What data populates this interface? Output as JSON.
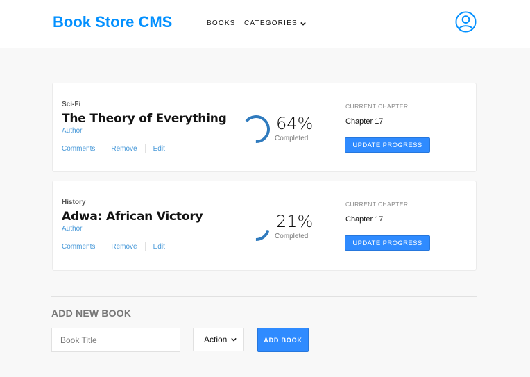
{
  "app": {
    "title": "Book Store CMS"
  },
  "nav": {
    "books": "BOOKS",
    "categories": "CATEGORIES"
  },
  "colors": {
    "accent": "#0290ff",
    "button": "#2f8bff",
    "link": "#4a9ad9"
  },
  "books": [
    {
      "category": "Sci-Fi",
      "title": "The Theory of Everything",
      "author": "Author",
      "actions": {
        "comments": "Comments",
        "remove": "Remove",
        "edit": "Edit"
      },
      "progress": 64,
      "percent_label": "64%",
      "completed_label": "Completed",
      "current_chapter_label": "CURRENT CHAPTER",
      "current_chapter": "Chapter 17",
      "update_label": "UPDATE PROGRESS"
    },
    {
      "category": "History",
      "title": "Adwa: African Victory",
      "author": "Author",
      "actions": {
        "comments": "Comments",
        "remove": "Remove",
        "edit": "Edit"
      },
      "progress": 21,
      "percent_label": "21%",
      "completed_label": "Completed",
      "current_chapter_label": "CURRENT CHAPTER",
      "current_chapter": "Chapter 17",
      "update_label": "UPDATE PROGRESS"
    }
  ],
  "add_form": {
    "heading": "ADD NEW BOOK",
    "title_placeholder": "Book Title",
    "category_selected": "Action",
    "submit_label": "ADD BOOK"
  },
  "icons": {
    "user": "user-circle-icon",
    "dropdown": "chevron-down-icon"
  }
}
